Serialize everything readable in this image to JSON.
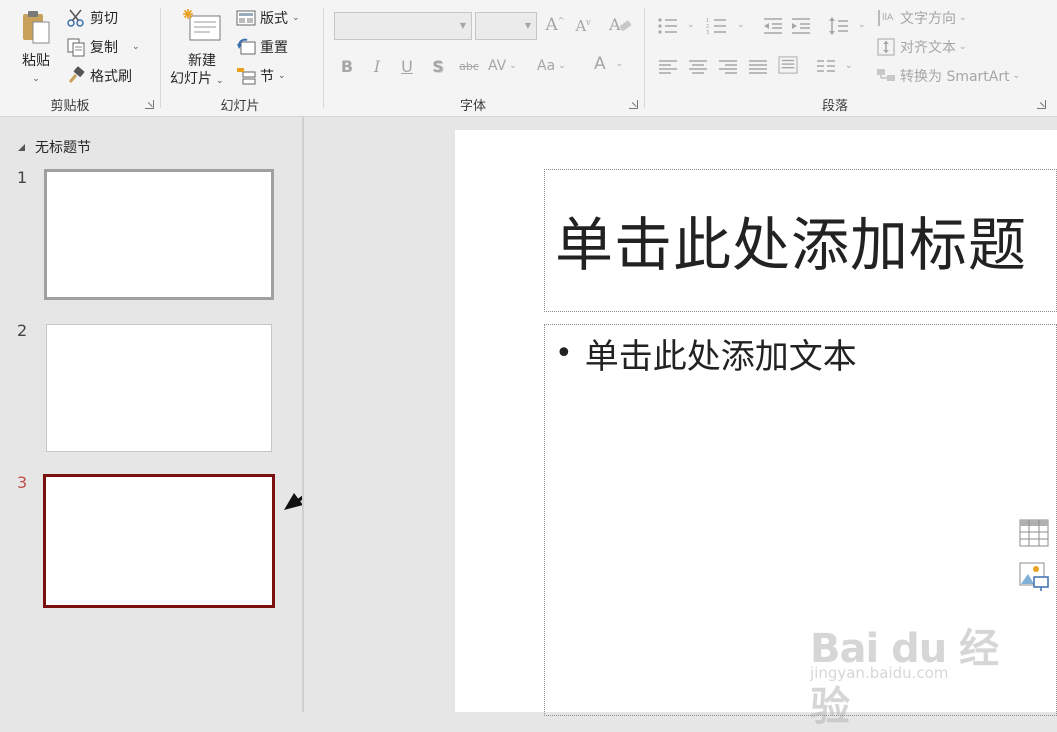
{
  "ribbon": {
    "clipboard": {
      "paste_label": "粘贴",
      "cut_label": "剪切",
      "copy_label": "复制",
      "format_painter_label": "格式刷",
      "group_label": "剪贴板"
    },
    "slides": {
      "new_slide_line1": "新建",
      "new_slide_line2": "幻灯片",
      "layout_label": "版式",
      "reset_label": "重置",
      "section_label": "节",
      "group_label": "幻灯片"
    },
    "font": {
      "font_name_value": "",
      "font_size_value": "",
      "grow_label": "A",
      "shrink_label": "A",
      "bold_label": "B",
      "italic_label": "I",
      "underline_label": "U",
      "shadow_label": "S",
      "strike_label": "abc",
      "spacing_label": "AV",
      "case_label": "Aa",
      "color_label": "A",
      "group_label": "字体"
    },
    "paragraph": {
      "text_direction_label": "文字方向",
      "align_text_label": "对齐文本",
      "smartart_label": "转换为 SmartArt",
      "group_label": "段落"
    }
  },
  "thumbnails": {
    "section_title": "无标题节",
    "slides": [
      {
        "number": "1"
      },
      {
        "number": "2"
      },
      {
        "number": "3"
      }
    ]
  },
  "slide": {
    "title_placeholder": "单击此处添加标题",
    "body_placeholder": "单击此处添加文本",
    "bullet": "•"
  },
  "watermark": {
    "brand": "Bai du 经验",
    "url": "jingyan.baidu.com"
  },
  "colors": {
    "active_slide_border": "#7b1010",
    "active_slide_number": "#c0504d",
    "ribbon_bg": "#f4f4f4",
    "pane_bg": "#e6e6e6"
  }
}
